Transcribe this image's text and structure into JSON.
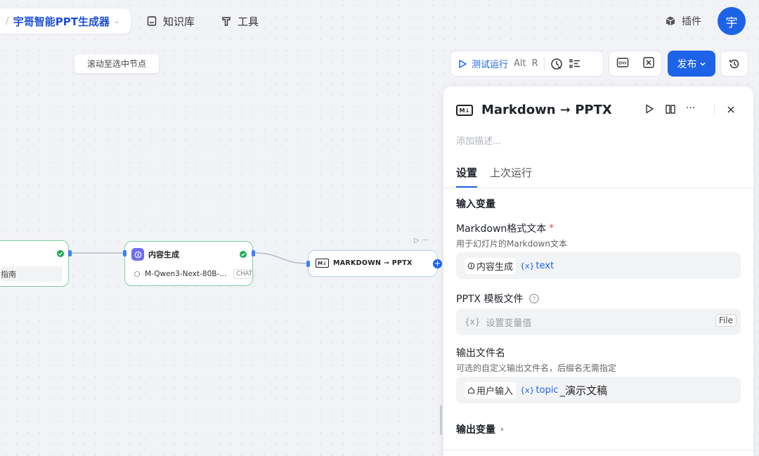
{
  "header": {
    "app_title": "宇哥智能PPT生成器",
    "nav": {
      "knowledge_base": "知识库",
      "tools": "工具",
      "plugins": "插件"
    },
    "avatar_text": "宇"
  },
  "toolbar": {
    "scroll_tip": "滚动至选中节点",
    "test_run_label": "测试运行",
    "shortcut_alt": "Alt",
    "shortcut_r": "R",
    "publish_label": "发布"
  },
  "nodes": {
    "start_chip": "指南",
    "content_title": "内容生成",
    "content_model": "M-Qwen3-Next-80B-...",
    "content_model_tag": "CHAT",
    "md_title": "MARKDOWN ➞ PPTX",
    "md_badge": "M↓"
  },
  "panel": {
    "title": "Markdown ➞ PPTX",
    "badge": "M↓",
    "description_placeholder": "添加描述...",
    "tabs": [
      "设置",
      "上次运行"
    ],
    "input_section": "输入变量",
    "fields": [
      {
        "label": "Markdown格式文本",
        "required_mark": "*",
        "hint": "用于幻灯片的Markdown文本",
        "ref_node": "内容生成",
        "ref_var": "text"
      },
      {
        "label": "PPTX 模板文件",
        "placeholder": "设置变量值",
        "type_tag": "File"
      },
      {
        "label": "输出文件名",
        "hint": "可选的自定义输出文件名，后缀名无需指定",
        "ref_node": "用户输入",
        "ref_var": "topic",
        "suffix": "_演示文稿"
      }
    ],
    "output_section": "输出变量"
  },
  "colors": {
    "accent": "#1d63e8",
    "success": "#1aaa55",
    "node_border_ok": "#7fd0a0",
    "node_border_selected": "#b8cdf2"
  }
}
